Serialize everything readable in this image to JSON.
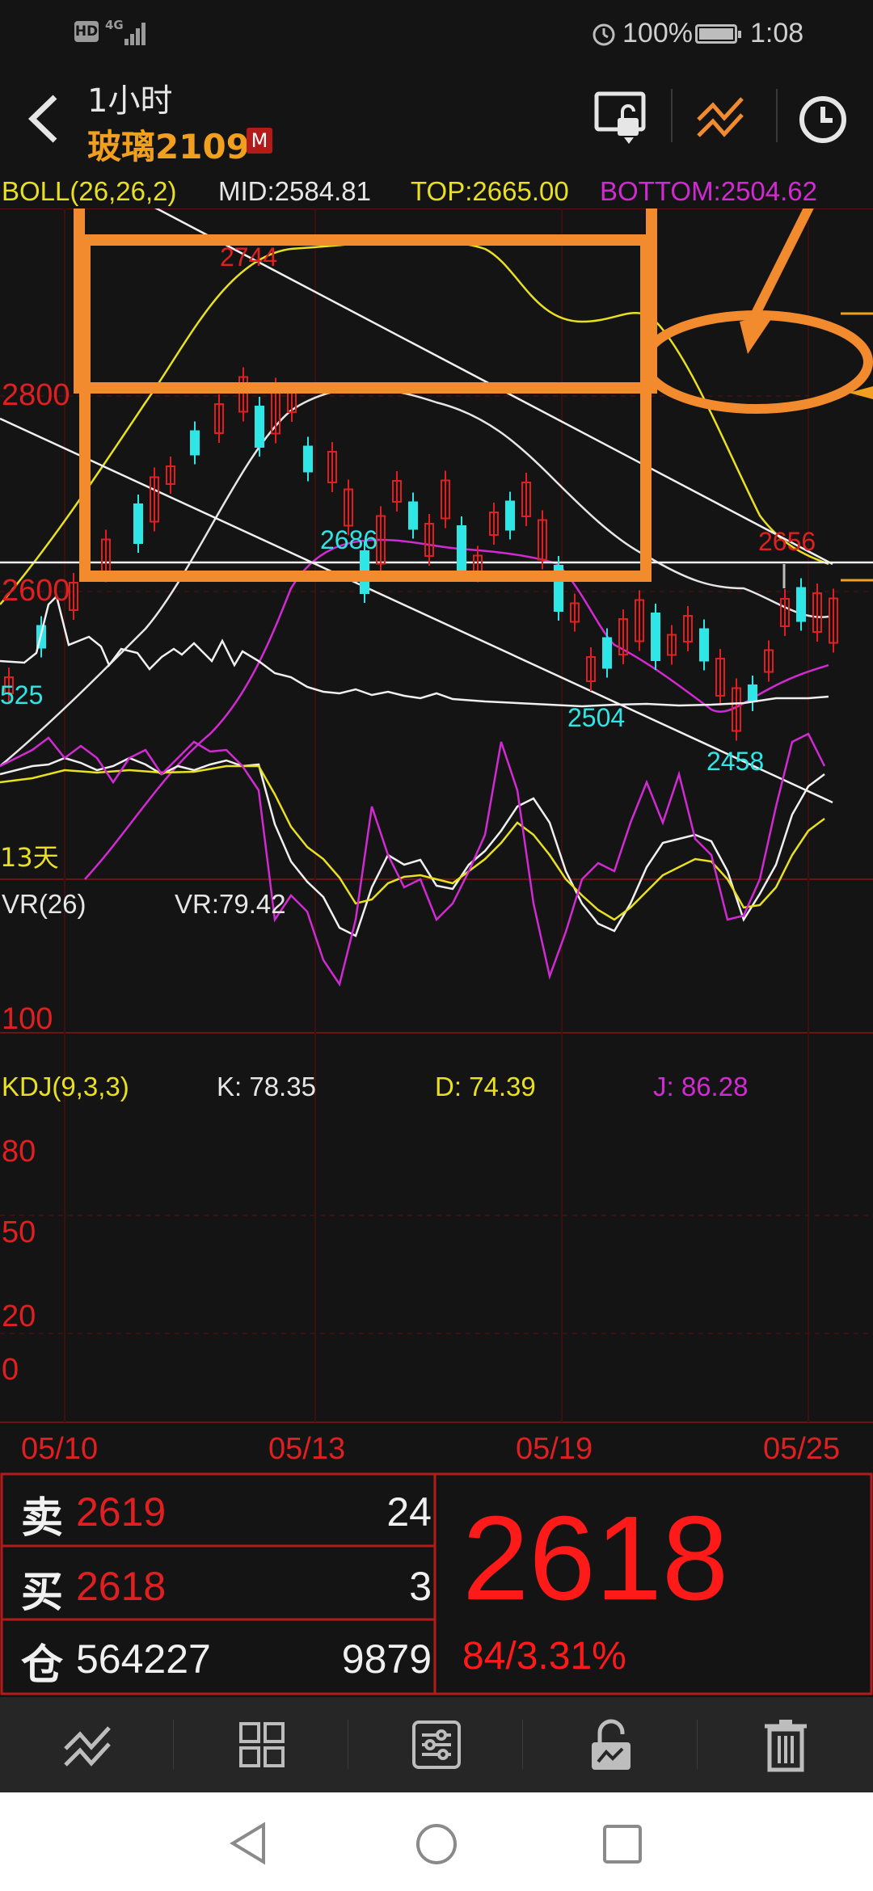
{
  "status_bar": {
    "left_icons": [
      "hd-icon",
      "4g-signal-icon"
    ],
    "hd_label": "HD",
    "network": "4G",
    "battery": "100%",
    "time": "1:08"
  },
  "header": {
    "timeframe": "1小时",
    "symbol": "玻璃2109",
    "badge": "M",
    "icons": [
      "back-icon",
      "unlock-screen-icon",
      "draw-line-icon",
      "clock-icon"
    ]
  },
  "boll": {
    "name": "BOLL(26,26,2)",
    "mid": "MID:2584.81",
    "top": "TOP:2665.00",
    "bottom": "BOTTOM:2504.62"
  },
  "main_chart": {
    "y_labels": [
      "2800",
      "2600"
    ],
    "annotations": [
      "2744",
      "2686",
      "2504",
      "2458",
      "2656",
      "525"
    ],
    "left_note": "13天"
  },
  "vr": {
    "name": "VR(26)",
    "value": "VR:79.42",
    "y_label": "100"
  },
  "kdj": {
    "name": "KDJ(9,3,3)",
    "k": "K: 78.35",
    "d": "D: 74.39",
    "j": "J: 86.28",
    "y_labels": [
      "80",
      "50",
      "20",
      "0"
    ]
  },
  "dates": [
    "05/10",
    "05/13",
    "05/19",
    "05/25"
  ],
  "quote": {
    "sell_label": "卖",
    "sell_price": "2619",
    "sell_qty": "24",
    "buy_label": "买",
    "buy_price": "2618",
    "buy_qty": "3",
    "oi_label": "仓",
    "oi_value": "564227",
    "oi_change": "9879",
    "last_price": "2618",
    "change": "84/3.31%"
  },
  "toolbar": {
    "items": [
      "draw-line-icon",
      "grid-icon",
      "settings-sliders-icon",
      "unlock-icon",
      "trash-icon"
    ]
  },
  "navbar": {
    "items": [
      "back-triangle-icon",
      "home-circle-icon",
      "recents-square-icon"
    ]
  },
  "colors": {
    "background": "#141414",
    "up": "#e02020",
    "down": "#2ee6e6",
    "boll_top": "#e8e020",
    "boll_bottom": "#d22ad2",
    "annotation_orange": "#f28a2e",
    "symbol_gold": "#f0a01e"
  }
}
